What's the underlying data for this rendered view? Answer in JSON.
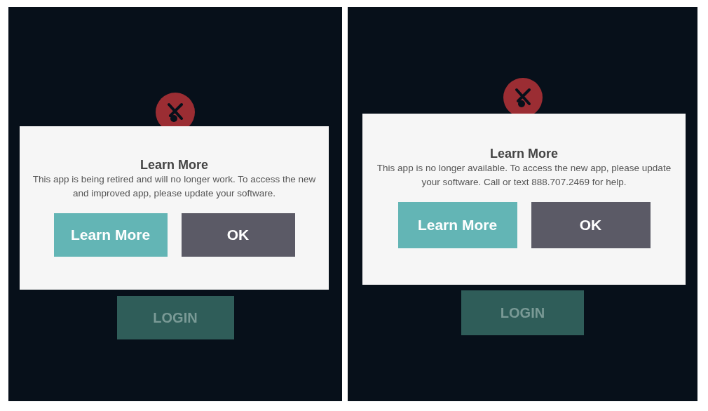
{
  "panels": [
    {
      "dialog": {
        "title": "Learn More",
        "message": "This app is being retired and will no longer work. To access the new and improved app, please update your software.",
        "buttons": [
          {
            "label": "Learn More",
            "kind": "primary"
          },
          {
            "label": "OK",
            "kind": "secondary"
          }
        ]
      },
      "login_button": {
        "label": "LOGIN",
        "disabled": true
      }
    },
    {
      "dialog": {
        "title": "Learn More",
        "message": "This app is no longer available. To access the new app, please update your software. Call or text 888.707.2469 for help.",
        "buttons": [
          {
            "label": "Learn More",
            "kind": "primary"
          },
          {
            "label": "OK",
            "kind": "secondary"
          }
        ]
      },
      "login_button": {
        "label": "LOGIN",
        "disabled": true
      }
    }
  ]
}
